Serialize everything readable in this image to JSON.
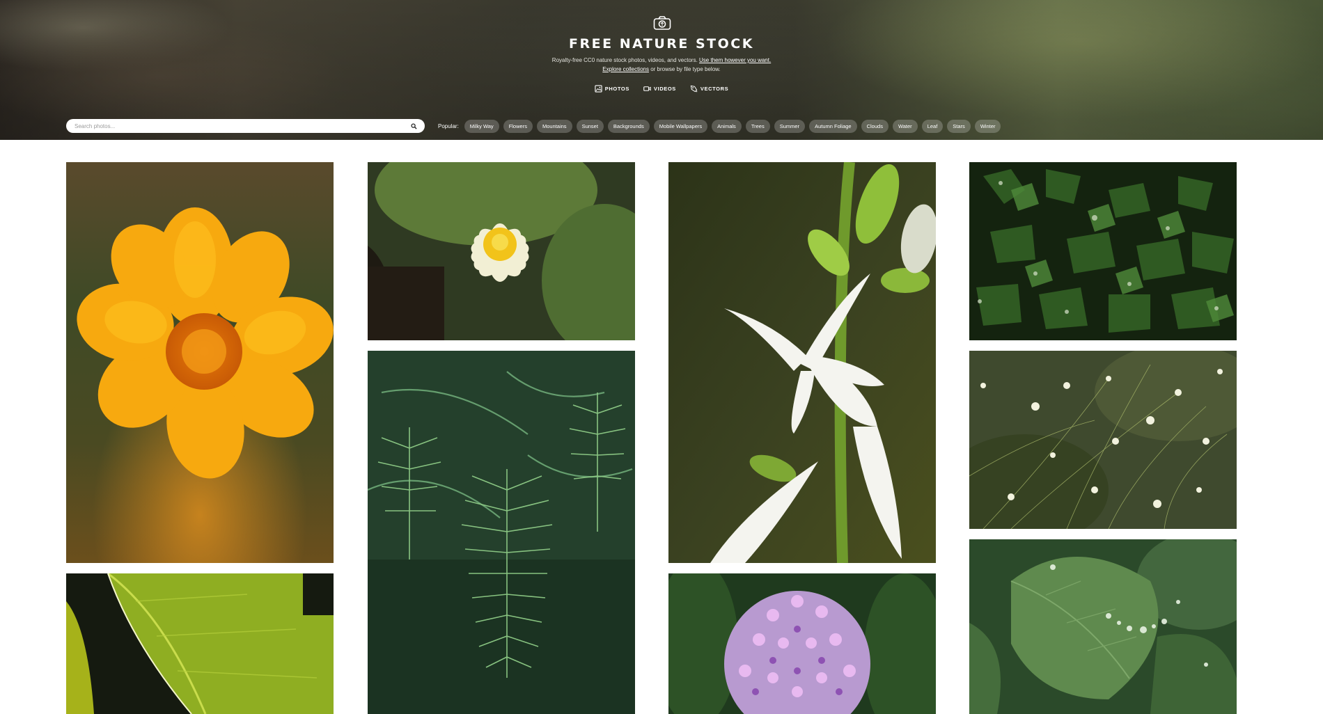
{
  "site": {
    "title": "FREE NATURE STOCK",
    "logo_icon": "camera-icon"
  },
  "tagline": {
    "line1_text": "Royalty-free CC0 nature stock photos, videos, and vectors.",
    "line1_link": "Use them however you want.",
    "line2_link": "Explore collections",
    "line2_text": "or browse by file type below."
  },
  "file_types": [
    {
      "label": "PHOTOS",
      "icon": "image-icon"
    },
    {
      "label": "VIDEOS",
      "icon": "video-camera-icon"
    },
    {
      "label": "VECTORS",
      "icon": "vector-pen-icon"
    }
  ],
  "search": {
    "placeholder": "Search photos...",
    "icon": "search-icon"
  },
  "popular": {
    "label": "Popular:",
    "tags": [
      "Milky Way",
      "Flowers",
      "Mountains",
      "Sunset",
      "Backgrounds",
      "Mobile Wallpapers",
      "Animals",
      "Trees",
      "Summer",
      "Autumn Foliage",
      "Clouds",
      "Water",
      "Leaf",
      "Stars",
      "Winter"
    ]
  },
  "colors": {
    "tag_background": "rgba(255,255,255,0.22)",
    "page_background": "#ffffff"
  },
  "photos": [
    {
      "subject": "orange-marigold-flower"
    },
    {
      "subject": "green-leaf-backlit"
    },
    {
      "subject": "white-water-lily"
    },
    {
      "subject": "dawn-redwood-fern-foliage"
    },
    {
      "subject": "white-hosta-lily"
    },
    {
      "subject": "purple-allium-flower"
    },
    {
      "subject": "holly-leaves"
    },
    {
      "subject": "white-wildflowers"
    },
    {
      "subject": "leaf-with-water-droplets"
    }
  ]
}
